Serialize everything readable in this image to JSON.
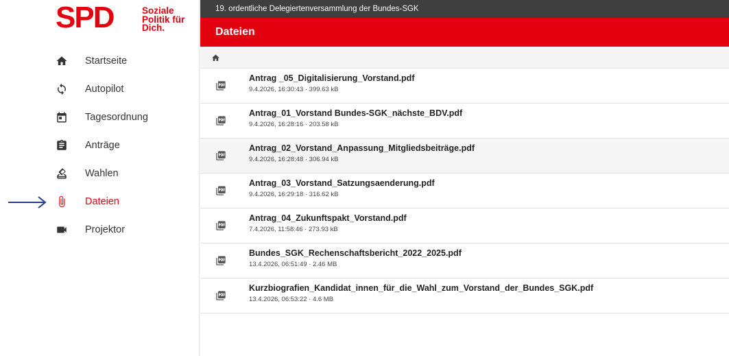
{
  "logo": {
    "wordmark": "SPD",
    "tagline": [
      "Soziale",
      "Politik für",
      "Dich."
    ]
  },
  "event": {
    "title": "19. ordentliche Delegiertenversammlung der Bundes-SGK"
  },
  "page": {
    "title": "Dateien"
  },
  "colors": {
    "brand": "#e3000f",
    "header_dark": "#3f3f3f",
    "arrow": "#1f3f87"
  },
  "nav": [
    {
      "label": "Startseite",
      "icon": "home-icon",
      "active": false
    },
    {
      "label": "Autopilot",
      "icon": "sync-icon",
      "active": false
    },
    {
      "label": "Tagesordnung",
      "icon": "calendar-icon",
      "active": false
    },
    {
      "label": "Anträge",
      "icon": "clipboard-icon",
      "active": false
    },
    {
      "label": "Wahlen",
      "icon": "ballot-icon",
      "active": false
    },
    {
      "label": "Dateien",
      "icon": "paperclip-icon",
      "active": true
    },
    {
      "label": "Projektor",
      "icon": "videocam-icon",
      "active": false
    }
  ],
  "breadcrumb": {
    "icon": "home-icon"
  },
  "files": [
    {
      "name": "Antrag _05_Digitalisierung_Vorstand.pdf",
      "meta": "9.4.2026, 16:30:43 · 399.63 kB"
    },
    {
      "name": "Antrag_01_Vorstand Bundes-SGK_nächste_BDV.pdf",
      "meta": "9.4.2026, 16:28:16 · 203.58 kB"
    },
    {
      "name": "Antrag_02_Vorstand_Anpassung_Mitgliedsbeiträge.pdf",
      "meta": "9.4.2026, 16:28:48 · 306.94 kB"
    },
    {
      "name": "Antrag_03_Vorstand_Satzungsaenderung.pdf",
      "meta": "9.4.2026, 16:29:18 · 316.62 kB"
    },
    {
      "name": "Antrag_04_Zukunftspakt_Vorstand.pdf",
      "meta": "7.4.2026, 11:58:46 · 273.93 kB"
    },
    {
      "name": "Bundes_SGK_Rechenschaftsbericht_2022_2025.pdf",
      "meta": "13.4.2026, 06:51:49 · 2.46 MB"
    },
    {
      "name": "Kurzbiografien_Kandidat_innen_für_die_Wahl_zum_Vorstand_der_Bundes_SGK.pdf",
      "meta": "13.4.2026, 06:53:22 · 4.6 MB"
    }
  ]
}
